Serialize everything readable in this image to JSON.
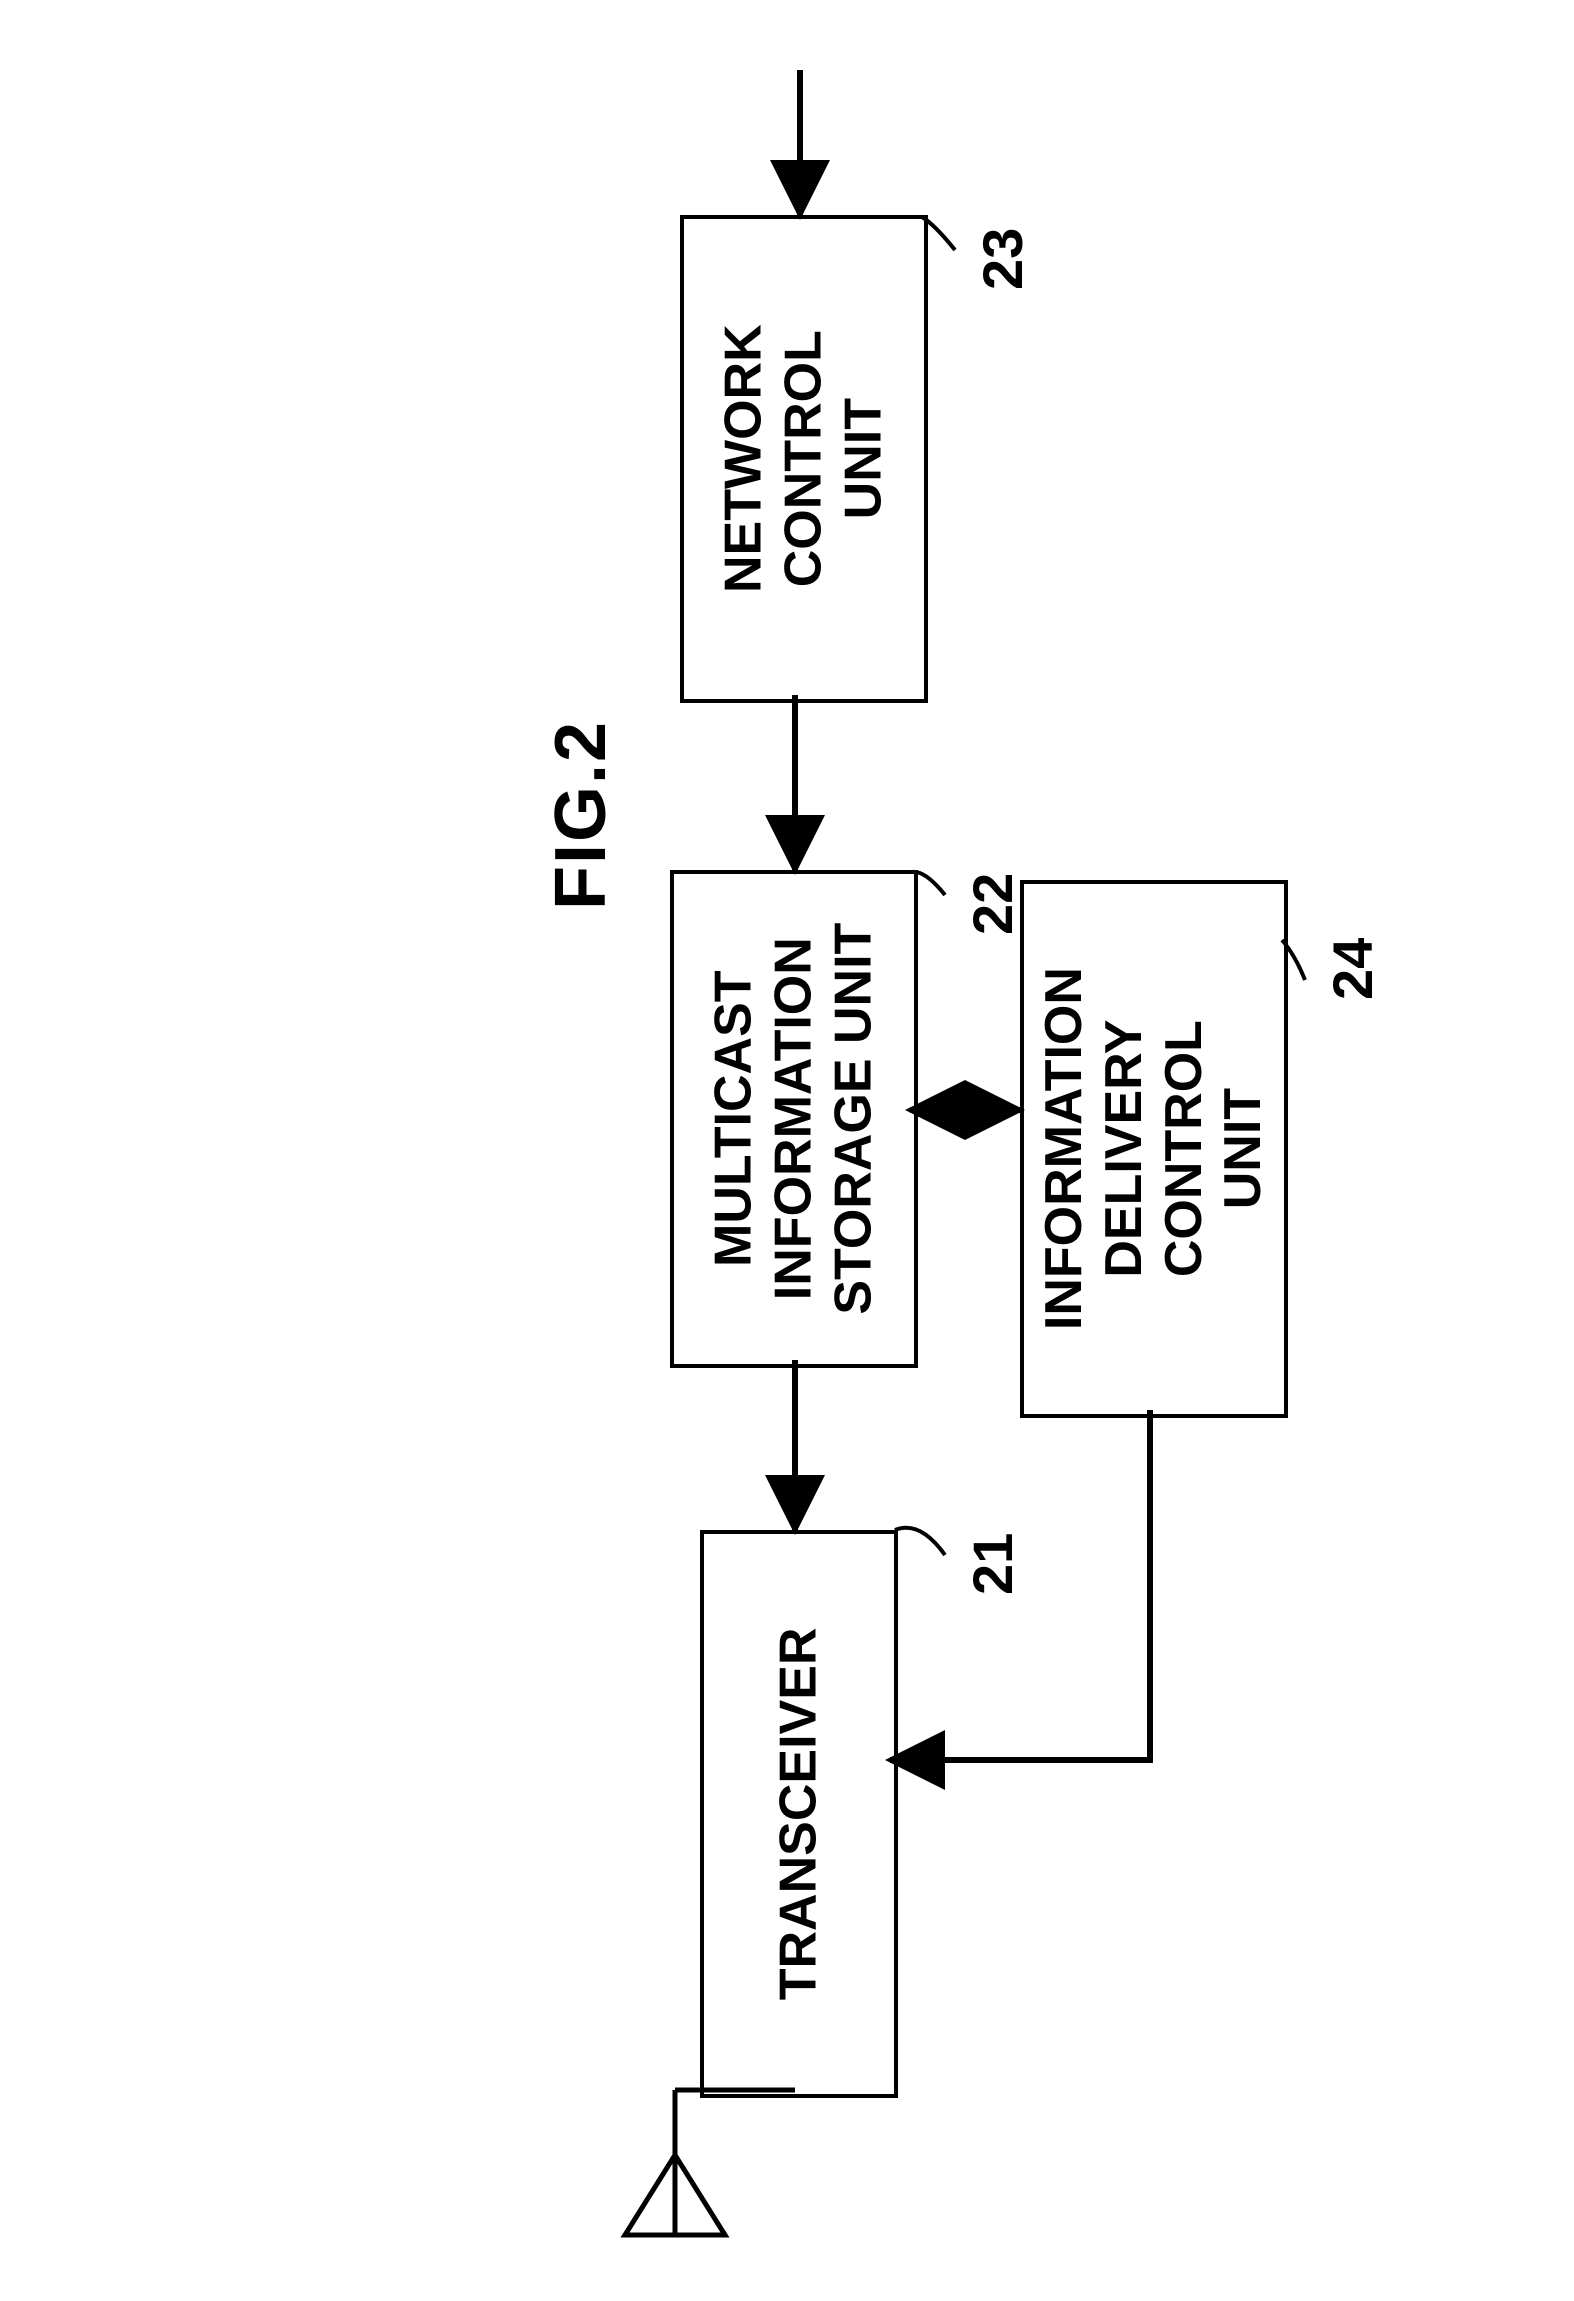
{
  "figure": {
    "title": "FIG.2"
  },
  "blocks": {
    "transceiver": {
      "label": "TRANSCEIVER",
      "ref": "21"
    },
    "storage": {
      "label": "MULTICAST\nINFORMATION\nSTORAGE UNIT",
      "ref": "22"
    },
    "network": {
      "label": "NETWORK\nCONTROL\nUNIT",
      "ref": "23"
    },
    "delivery": {
      "label": "INFORMATION\nDELIVERY\nCONTROL\nUNIT",
      "ref": "24"
    }
  }
}
